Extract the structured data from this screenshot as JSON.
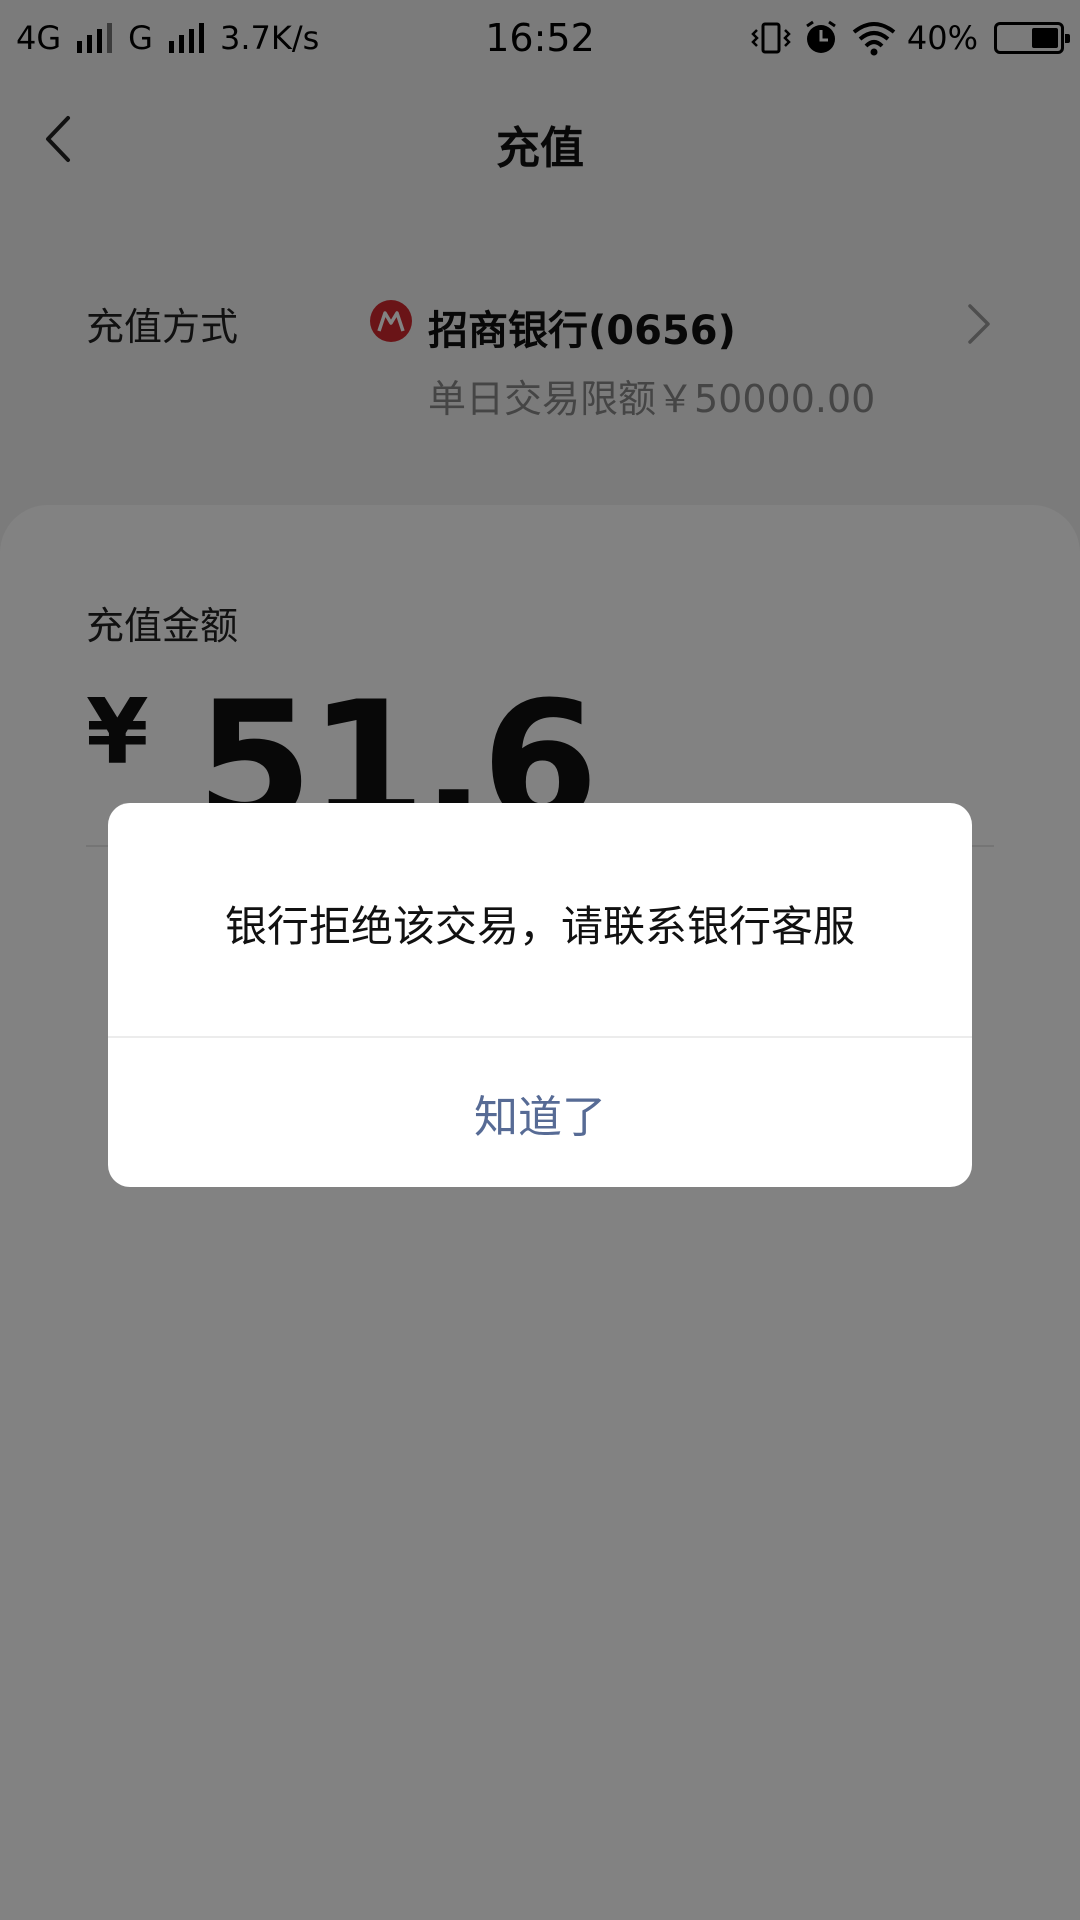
{
  "status_bar": {
    "network_1": "4G",
    "network_2": "G",
    "speed": "3.7K/s",
    "time": "16:52",
    "battery": "40%",
    "icons": [
      "signal-icon",
      "vibrate-icon",
      "alarm-icon",
      "wifi-icon",
      "battery-icon"
    ]
  },
  "nav": {
    "title": "充值",
    "back_icon": "chevron-left-icon"
  },
  "method": {
    "label": "充值方式",
    "bank_name": "招商银行(0656)",
    "limit": "单日交易限额￥50000.00",
    "bank_color": "#d0282e"
  },
  "amount": {
    "label": "充值金额",
    "currency": "¥",
    "value": "51.6"
  },
  "dialog": {
    "message": "银行拒绝该交易，请联系银行客服",
    "button": "知道了",
    "button_color": "#576b95"
  }
}
